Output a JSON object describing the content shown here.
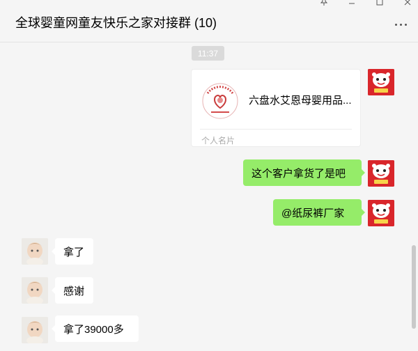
{
  "header": {
    "title": "全球婴童网童友快乐之家对接群 (10)"
  },
  "window_controls": [
    "pin-icon",
    "minimize-icon",
    "maximize-icon",
    "close-icon"
  ],
  "chat": {
    "timestamp": "11:37",
    "card": {
      "name": "六盘水艾恩母婴用品...",
      "type_label": "个人名片"
    },
    "messages": [
      {
        "from": "me",
        "text": "这个客户拿货了是吧"
      },
      {
        "from": "me",
        "text": "@纸尿裤厂家"
      },
      {
        "from": "other",
        "text": "拿了"
      },
      {
        "from": "other",
        "text": "感谢"
      },
      {
        "from": "other",
        "text": "拿了39000多"
      }
    ]
  },
  "colors": {
    "my_bubble": "#95ec69",
    "other_bubble": "#ffffff",
    "background": "#f5f5f5",
    "my_avatar": "#d9262b"
  }
}
